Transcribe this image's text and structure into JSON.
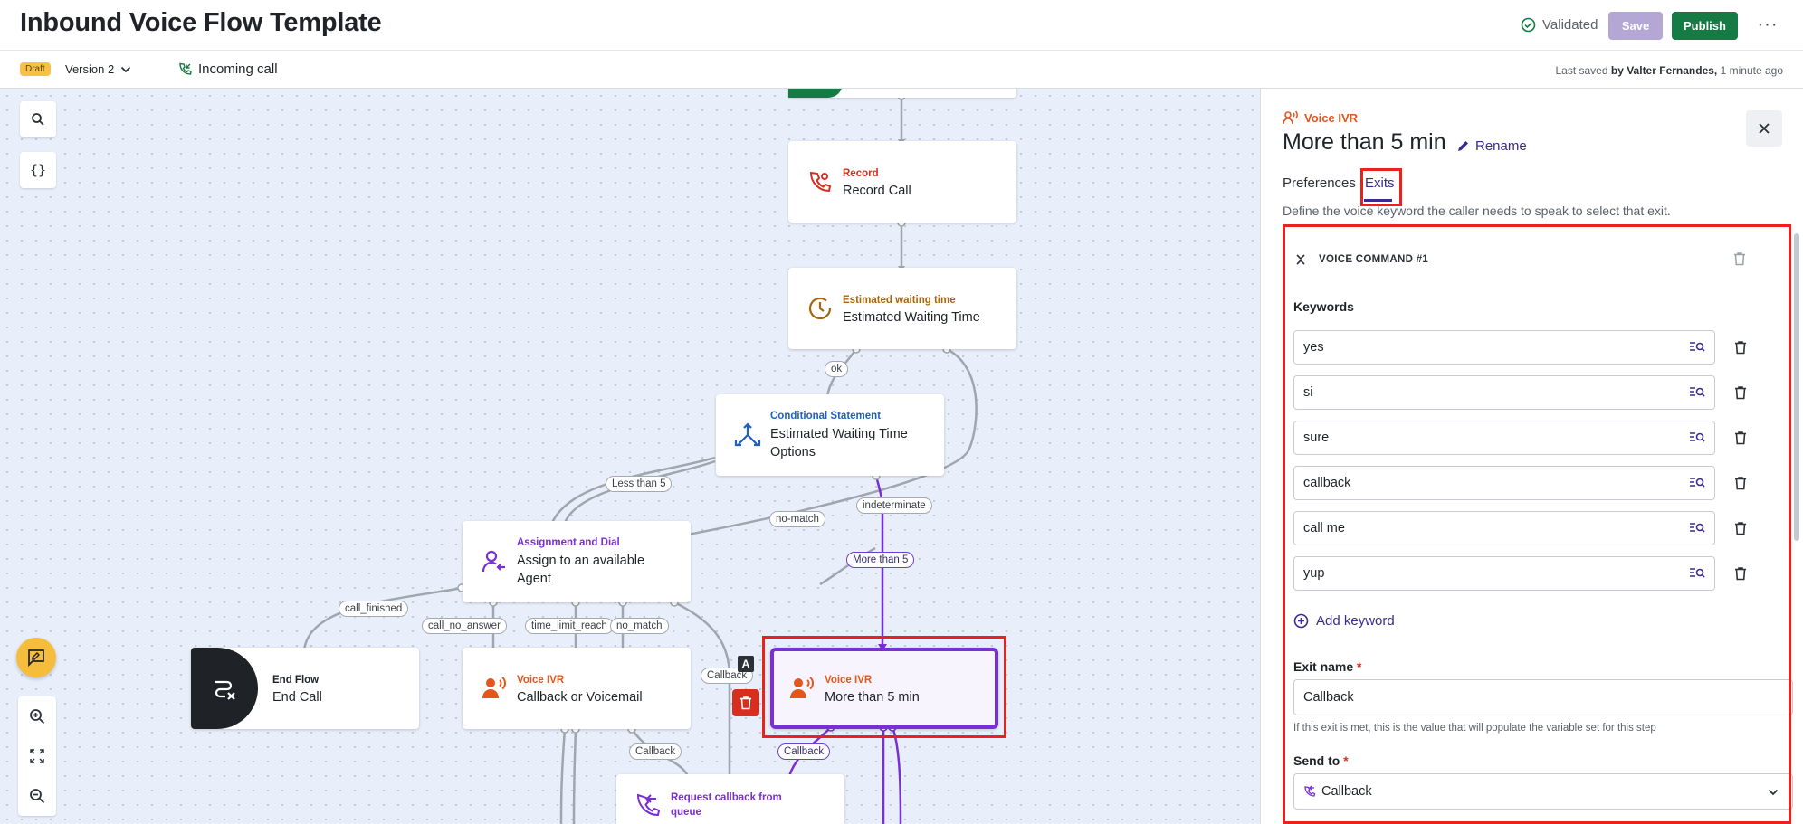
{
  "header": {
    "title": "Inbound Voice Flow Template",
    "status": "Validated",
    "save_label": "Save",
    "publish_label": "Publish",
    "more_label": "···"
  },
  "subbar": {
    "badge": "Draft",
    "version": "Version 2",
    "trigger": "Incoming call",
    "saved_prefix": "Last saved",
    "saved_by": "by Valter Fernandes,",
    "saved_time": "1 minute ago"
  },
  "canvas": {
    "tools": {
      "search_icon": "search-icon",
      "variables_label": "{}"
    },
    "nodes": [
      {
        "id": "record",
        "type": "Record",
        "name": "Record Call",
        "color": "#d92d20"
      },
      {
        "id": "waiting",
        "type": "Estimated waiting time",
        "name": "Estimated Waiting Time",
        "color": "#a8650b"
      },
      {
        "id": "conditional",
        "type": "Conditional Statement",
        "name": "Estimated Waiting Time Options",
        "color": "#1f5fbf"
      },
      {
        "id": "assign",
        "type": "Assignment and Dial",
        "name": "Assign to an available Agent",
        "color": "#7a2ed6"
      },
      {
        "id": "endflow",
        "type": "End Flow",
        "name": "End Call",
        "color": "#1f2328"
      },
      {
        "id": "callback_vm",
        "type": "Voice IVR",
        "name": "Callback or Voicemail",
        "color": "#e4561b"
      },
      {
        "id": "more5",
        "type": "Voice IVR",
        "name": "More than 5 min",
        "color": "#e4561b"
      },
      {
        "id": "request_cb",
        "type": "Request callback from queue",
        "name": "",
        "color": "#7a2ed6"
      }
    ],
    "edge_labels": {
      "ok": "ok",
      "less5": "Less than 5",
      "nomatch1": "no-match",
      "indeterminate": "indeterminate",
      "more5": "More than 5",
      "call_finished": "call_finished",
      "call_no_answer": "call_no_answer",
      "time_limit": "time_limit_reach",
      "no_match": "no_match",
      "callback1": "Callback",
      "callback2": "Callback",
      "callback3": "Callback"
    },
    "a_badge": "A"
  },
  "panel": {
    "type": "Voice IVR",
    "name": "More than 5 min",
    "rename_label": "Rename",
    "tabs": [
      "Preferences",
      "Exits"
    ],
    "active_tab": "Exits",
    "description": "Define the voice keyword the caller needs to speak to select that exit.",
    "voice_command_title": "VOICE COMMAND #1",
    "keywords_label": "Keywords",
    "keywords": [
      "yes",
      "si",
      "sure",
      "callback",
      "call me",
      "yup"
    ],
    "add_keyword_label": "Add keyword",
    "exit_name_label": "Exit name",
    "exit_name_value": "Callback",
    "exit_name_help": "If this exit is met, this is the value that will populate the variable set for this step",
    "send_to_label": "Send to",
    "send_to_value": "Callback",
    "required_mark": "*"
  },
  "colors": {
    "accent_purple": "#3b2a8f",
    "publish_green": "#157a43",
    "highlight_red": "#e8221c",
    "voice_orange": "#e4561b"
  }
}
